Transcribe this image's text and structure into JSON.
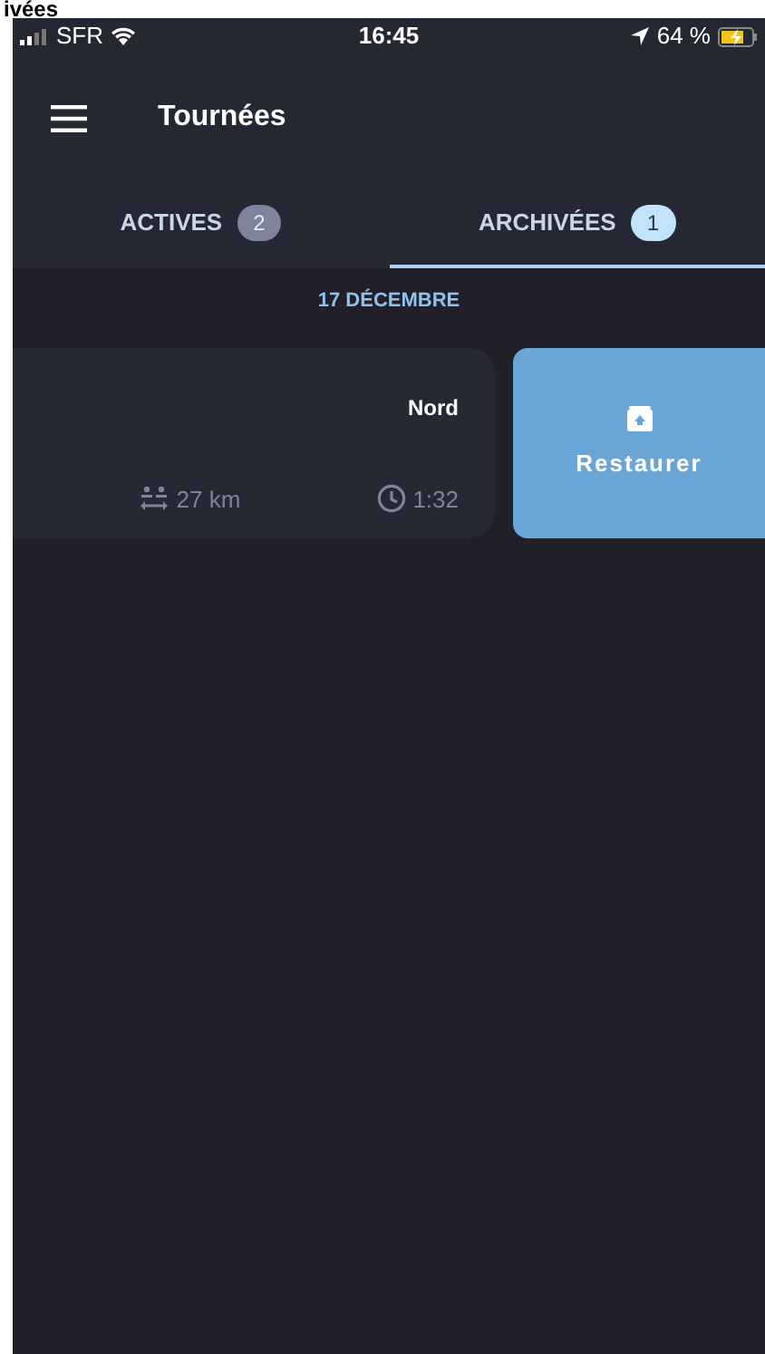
{
  "caption": "ivées",
  "status_bar": {
    "carrier": "SFR",
    "time": "16:45",
    "battery": "64 %"
  },
  "header": {
    "title": "Tournées"
  },
  "tabs": [
    {
      "label": "ACTIVES",
      "count": "2",
      "selected": false
    },
    {
      "label": "ARCHIVÉES",
      "count": "1",
      "selected": true
    }
  ],
  "sections": [
    {
      "date": "17 DÉCEMBRE",
      "tours": [
        {
          "zone": "Nord",
          "distance": "27 km",
          "duration": "1:32",
          "action": "Restaurer"
        }
      ]
    }
  ]
}
